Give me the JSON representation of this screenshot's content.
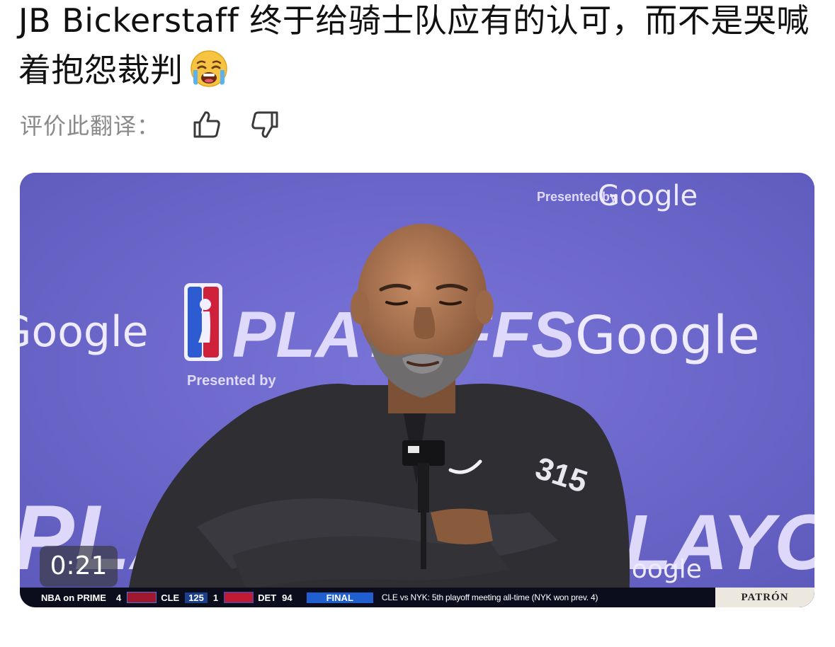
{
  "post": {
    "title": "JB Bickerstaff 终于给骑士队应有的认可，而不是哭喊着抱怨裁判",
    "title_emoji": "loudly-crying-face-emoji"
  },
  "translation_rating": {
    "label": "评价此翻译：",
    "thumbs_up_icon": "thumbs-up-icon",
    "thumbs_down_icon": "thumbs-down-icon"
  },
  "video": {
    "duration": "0:21",
    "backdrop_texts": {
      "playoffs": "PLAYOFFS",
      "presented_by": "Presented by",
      "google": "Google"
    },
    "ticker": {
      "network": "NBA on PRIME",
      "seed_a": "4",
      "team_a": "CLE",
      "score_a": "125",
      "seed_b": "1",
      "team_b": "DET",
      "score_b": "94",
      "status": "FINAL",
      "info": "CLE vs NYK: 5th playoff meeting all-time (NYK won prev. 4)",
      "sponsor": "PATRÓN"
    }
  },
  "colors": {
    "backdrop": "#6a66c8",
    "ticker_bg": "#0b0d1c",
    "final_badge": "#1f5fd0"
  }
}
